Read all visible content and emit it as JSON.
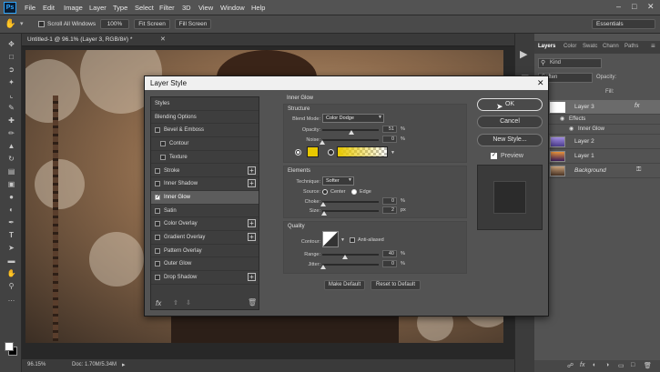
{
  "app": {
    "logo": "Ps"
  },
  "menu": [
    "File",
    "Edit",
    "Image",
    "Layer",
    "Type",
    "Select",
    "Filter",
    "3D",
    "View",
    "Window",
    "Help"
  ],
  "options": {
    "scroll_all": "Scroll All Windows",
    "zoom": "100%",
    "fit": "Fit Screen",
    "fill": "Fill Screen",
    "workspace": "Essentials"
  },
  "document": {
    "tab": "Untitled-1 @ 96.1% (Layer 3, RGB/8#) *",
    "zoom_status": "96.15%",
    "doc_status": "Doc: 1.70M/5.34M"
  },
  "panels": {
    "tabs": [
      "Layers",
      "Color",
      "Swatc",
      "Chann",
      "Paths"
    ],
    "kind": "Kind",
    "blend": "Soften",
    "opacity_label": "Opacity:",
    "fill_label": "Fill:",
    "layers": [
      {
        "name": "Layer 3",
        "fx": "fx"
      },
      {
        "name": "Effects"
      },
      {
        "name": "Inner Glow"
      },
      {
        "name": "Layer 2"
      },
      {
        "name": "Layer 1"
      },
      {
        "name": "Background"
      }
    ]
  },
  "dialog": {
    "title": "Layer Style",
    "styles": [
      "Styles",
      "Blending Options",
      "Bevel & Emboss",
      "Contour",
      "Texture",
      "Stroke",
      "Inner Shadow",
      "Inner Glow",
      "Satin",
      "Color Overlay",
      "Gradient Overlay",
      "Pattern Overlay",
      "Outer Glow",
      "Drop Shadow"
    ],
    "fx": "fx",
    "section": "Inner Glow",
    "structure": {
      "title": "Structure",
      "blend_label": "Blend Mode:",
      "blend_value": "Color Dodge",
      "opacity_label": "Opacity:",
      "opacity_value": "51",
      "noise_label": "Noise:",
      "noise_value": "0",
      "unit": "%",
      "opacity_pct": 0.51,
      "noise_pct": 0.0,
      "glow_color": "#e8c800"
    },
    "elements": {
      "title": "Elements",
      "technique_label": "Technique:",
      "technique_value": "Softer",
      "source_label": "Source:",
      "center": "Center",
      "edge": "Edge",
      "choke_label": "Choke:",
      "choke_value": "0",
      "size_label": "Size:",
      "size_value": "2",
      "unit_pct": "%",
      "unit_px": "px"
    },
    "quality": {
      "title": "Quality",
      "contour_label": "Contour:",
      "antialiased": "Anti-aliased",
      "range_label": "Range:",
      "range_value": "40",
      "jitter_label": "Jitter:",
      "jitter_value": "0",
      "unit": "%",
      "range_pct": 0.4
    },
    "make_default": "Make Default",
    "reset_default": "Reset to Default",
    "buttons": {
      "ok": "OK",
      "cancel": "Cancel",
      "new_style": "New Style...",
      "preview": "Preview"
    }
  },
  "colors": {
    "accent": "#31a8ff",
    "glow": "#e8c800"
  }
}
